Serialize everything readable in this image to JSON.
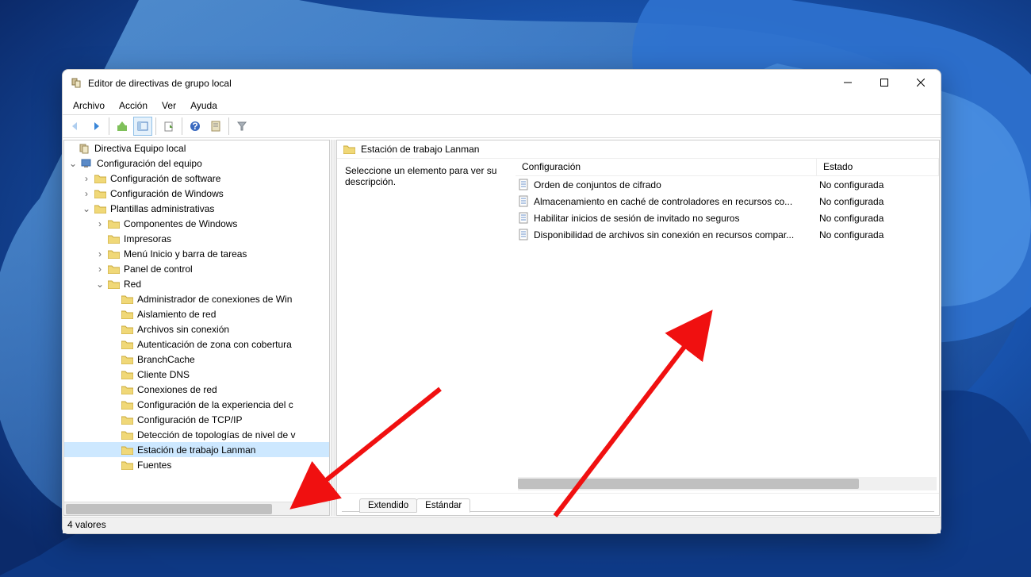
{
  "window": {
    "title": "Editor de directivas de grupo local",
    "menus": [
      "Archivo",
      "Acción",
      "Ver",
      "Ayuda"
    ]
  },
  "tree": {
    "root": "Directiva Equipo local",
    "computer_config": "Configuración del equipo",
    "software": "Configuración de software",
    "windows": "Configuración de Windows",
    "templates": "Plantillas administrativas",
    "components": "Componentes de Windows",
    "printers": "Impresoras",
    "startmenu": "Menú Inicio y barra de tareas",
    "controlpanel": "Panel de control",
    "network": "Red",
    "net_items": [
      "Administrador de conexiones de Win",
      "Aislamiento de red",
      "Archivos sin conexión",
      "Autenticación de zona con cobertura",
      "BranchCache",
      "Cliente DNS",
      "Conexiones de red",
      "Configuración de la experiencia del c",
      "Configuración de TCP/IP",
      "Detección de topologías de nivel de v",
      "Estación de trabajo Lanman",
      "Fuentes"
    ]
  },
  "content": {
    "header": "Estación de trabajo Lanman",
    "description": "Seleccione un elemento para ver su descripción.",
    "columns": {
      "config": "Configuración",
      "state": "Estado"
    },
    "rows": [
      {
        "name": "Orden de conjuntos de cifrado",
        "state": "No configurada"
      },
      {
        "name": "Almacenamiento en caché de controladores en recursos co...",
        "state": "No configurada"
      },
      {
        "name": "Habilitar inicios de sesión de invitado no seguros",
        "state": "No configurada"
      },
      {
        "name": "Disponibilidad de archivos sin conexión en recursos compar...",
        "state": "No configurada"
      }
    ],
    "tabs": {
      "extended": "Extendido",
      "standard": "Estándar"
    }
  },
  "status": "4 valores"
}
